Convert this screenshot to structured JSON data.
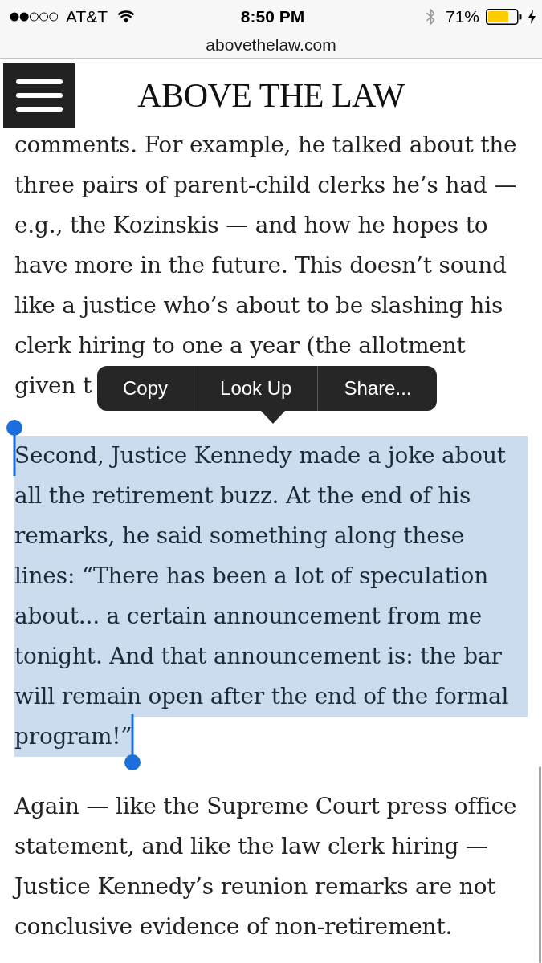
{
  "status_bar": {
    "carrier": "AT&T",
    "time": "8:50 PM",
    "battery_percent": "71%"
  },
  "address_bar": {
    "url": "abovethelaw.com"
  },
  "header": {
    "logo": "ABOVE THE LAW"
  },
  "article": {
    "paragraphs": [
      {
        "selected": false,
        "lines": [
          "comments. For example, he talked about the",
          "three pairs of parent-child clerks he’s had —",
          "e.g., the Kozinskis — and how he hopes to",
          "have more in the future. This doesn’t sound",
          "like a justice who’s about to be slashing his",
          "clerk hiring to one a year (the allotment"
        ],
        "partial_line": "given t"
      },
      {
        "selected": true,
        "lines": [
          "Second, Justice Kennedy made a joke about",
          "all the retirement buzz. At the end of his",
          "remarks, he said something along these",
          "lines: “There has been a lot of speculation",
          "about... a certain announcement from me",
          "tonight. And that announcement is: the bar",
          "will remain open after the end of the formal",
          "program!”"
        ]
      },
      {
        "selected": false,
        "lines": [
          "Again — like the Supreme Court press office",
          "statement, and like the law clerk hiring —",
          "Justice Kennedy’s reunion remarks are not",
          "conclusive evidence of non-retirement."
        ]
      }
    ]
  },
  "edit_menu": {
    "items": [
      "Copy",
      "Look Up",
      "Share..."
    ]
  }
}
